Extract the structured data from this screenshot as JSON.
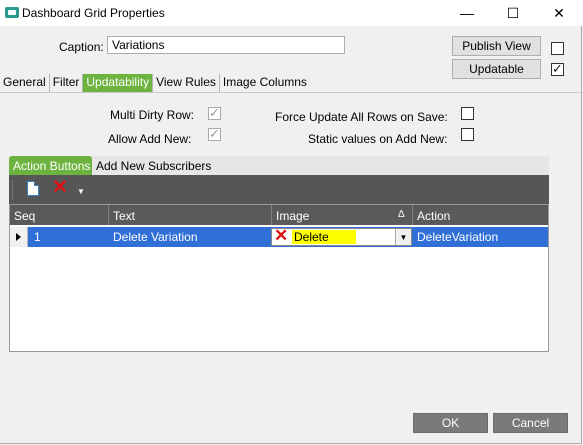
{
  "window": {
    "title": "Dashboard Grid Properties",
    "minimize_glyph": "—",
    "maximize_glyph": "☐",
    "close_glyph": "✕"
  },
  "caption": {
    "label": "Caption:",
    "value": "Variations"
  },
  "buttons": {
    "publish_view": "Publish View",
    "updatable": "Updatable"
  },
  "top_checkboxes": {
    "publish_view_checked": false,
    "updatable_checked": true
  },
  "tabs": [
    "General",
    "Filter",
    "Updatability",
    "View Rules",
    "Image Columns"
  ],
  "active_tab": "Updatability",
  "options": {
    "multi_dirty_row": {
      "label": "Multi Dirty Row:",
      "checked": true,
      "disabled": true
    },
    "allow_add_new": {
      "label": "Allow Add New:",
      "checked": true,
      "disabled": true
    },
    "force_update_all_rows": {
      "label": "Force Update All Rows on Save:",
      "checked": false
    },
    "static_values_on_add_new": {
      "label": "Static values on Add New:",
      "checked": false
    }
  },
  "panel_tabs": [
    "Action Buttons",
    "Add New Subscribers"
  ],
  "active_panel_tab": "Action Buttons",
  "toolbar": {
    "icons": [
      "new-document-icon",
      "delete-icon",
      "dropdown-caret-icon"
    ]
  },
  "grid": {
    "columns": [
      "Seq",
      "Text",
      "Image",
      "Action"
    ],
    "sort_indicator": "Δ",
    "rows": [
      {
        "seq": "1",
        "text": "Delete Variation",
        "image": "Delete",
        "action": "DeleteVariation"
      }
    ]
  },
  "footer": {
    "ok": "OK",
    "cancel": "Cancel"
  },
  "colors": {
    "accent_green": "#6db33f",
    "selection_blue": "#2f6fd6",
    "toolbar_gray": "#565656",
    "highlight_yellow": "#ffff00"
  }
}
